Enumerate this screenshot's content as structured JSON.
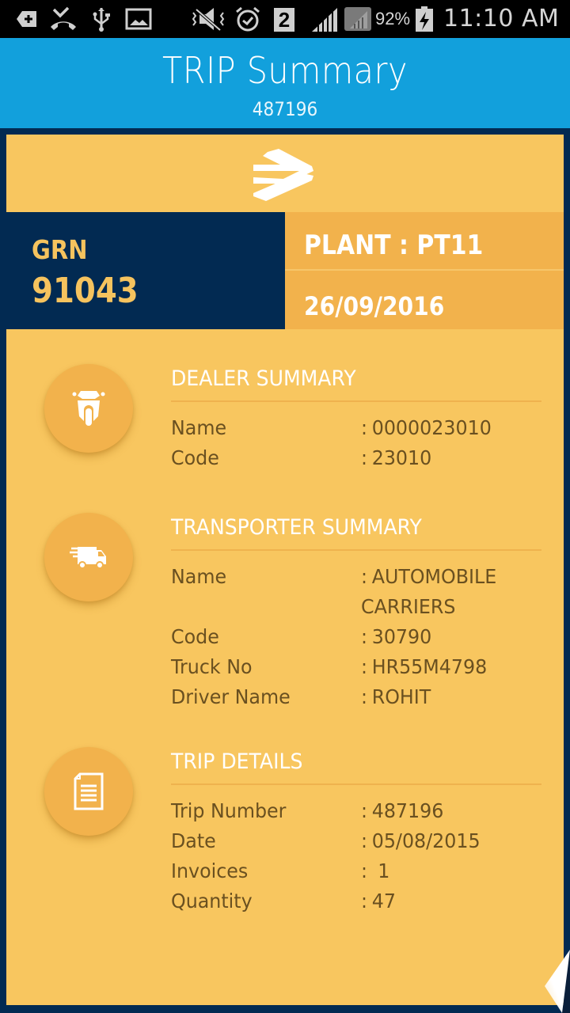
{
  "status_bar": {
    "left_icons": [
      "add-notification-icon",
      "missed-call-icon",
      "usb-icon",
      "gallery-icon"
    ],
    "right_icons": [
      "mute-icon",
      "alarm-icon",
      "sim-2-badge",
      "signal-icon",
      "signal-secondary-icon",
      "battery-charging-icon"
    ],
    "sim_badge": "2",
    "battery": "92%",
    "time": "11:10 AM"
  },
  "header": {
    "title": "TRIP Summary",
    "subtitle": "487196"
  },
  "colors": {
    "appbar": "#12a0dc",
    "navy": "#022a52",
    "card": "#f8c65f",
    "accent": "#f2b24c",
    "text": "#6a5020"
  },
  "banner": {
    "logo": "brand-logo-icon",
    "grn_label": "GRN",
    "grn_value": "91043",
    "plant": "PLANT : PT11",
    "date": "26/09/2016"
  },
  "sections": [
    {
      "icon": "scooter-icon",
      "title": "DEALER SUMMARY",
      "rows": [
        {
          "label": "Name",
          "value": "0000023010"
        },
        {
          "label": "Code",
          "value": "23010"
        }
      ]
    },
    {
      "icon": "delivery-truck-icon",
      "title": "TRANSPORTER SUMMARY",
      "rows": [
        {
          "label": "Name",
          "value": "AUTOMOBILE CARRIERS"
        },
        {
          "label": "Code",
          "value": "30790"
        },
        {
          "label": "Truck No",
          "value": "HR55M4798"
        },
        {
          "label": "Driver Name",
          "value": "ROHIT"
        }
      ]
    },
    {
      "icon": "document-icon",
      "title": "TRIP DETAILS",
      "rows": [
        {
          "label": "Trip Number",
          "value": "487196"
        },
        {
          "label": "Date",
          "value": "05/08/2015"
        },
        {
          "label": "Invoices",
          "value": " 1"
        },
        {
          "label": "Quantity",
          "value": "47"
        }
      ]
    }
  ],
  "colon": ":"
}
